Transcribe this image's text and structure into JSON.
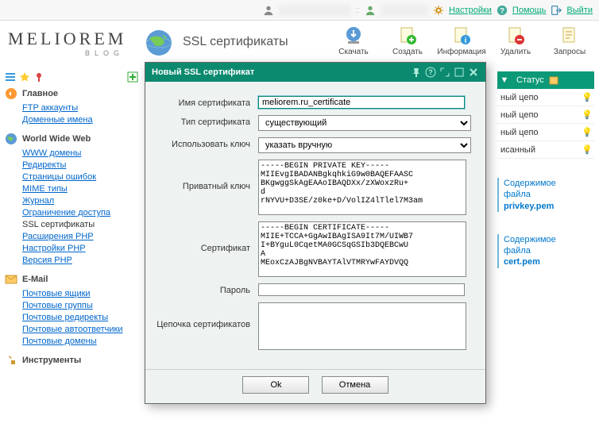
{
  "topbar": {
    "settings": "Настройки",
    "help": "Помощь",
    "logout": "Выйти"
  },
  "logo": {
    "main": "MELIOREM",
    "sub": "BLOG"
  },
  "page_title": "SSL сертификаты",
  "tools": {
    "download": "Скачать",
    "create": "Создать",
    "info": "Информация",
    "delete": "Удалить",
    "requests": "Запросы"
  },
  "sidebar": {
    "main": {
      "head": "Главное",
      "items": [
        "FTP аккаунты",
        "Доменные имена"
      ]
    },
    "www": {
      "head": "World Wide Web",
      "items": [
        "WWW домены",
        "Редиректы",
        "Страницы ошибок",
        "MIME типы",
        "Журнал",
        "Ограничение доступа"
      ],
      "current": "SSL сертификаты",
      "items2": [
        "Расширения PHP",
        "Настройки PHP",
        "Версия PHP"
      ]
    },
    "email": {
      "head": "E-Mail",
      "items": [
        "Почтовые ящики",
        "Почтовые группы",
        "Почтовые редиректы",
        "Почтовые автоответчики",
        "Почтовые домены"
      ]
    },
    "tools": {
      "head": "Инструменты"
    }
  },
  "rightcol": {
    "status_head": "Статус",
    "rows": [
      "ный цепо",
      "ный цепо",
      "ный цепо",
      "исанный"
    ],
    "anno1": [
      "Содержимое",
      "файла",
      "privkey.pem"
    ],
    "anno2": [
      "Содержимое",
      "файла",
      "cert.pem"
    ]
  },
  "modal": {
    "title": "Новый SSL сертификат",
    "labels": {
      "name": "Имя сертификата",
      "type": "Тип сертификата",
      "usekey": "Использовать ключ",
      "private": "Приватный ключ",
      "cert": "Сертификат",
      "password": "Пароль",
      "chain": "Цепочка сертификатов"
    },
    "values": {
      "name": "meliorem.ru_certificate",
      "type": "существующий",
      "usekey": "указать вручную",
      "private": "-----BEGIN PRIVATE KEY-----\nMIIEvgIBADANBgkqhkiG9w0BAQEFAASC\nBKgwggSkAgEAAoIBAQDXx/zXWoxzRu+\nd\nrNYVU+D3SE/z0ke+D/VolIZ4lTlel7M3am",
      "cert": "-----BEGIN CERTIFICATE-----\nMIIE+TCCA+GgAwIBAgISA9It7M/UIWB7\nI+BYguL0CqetMA0GCSqGSIb3DQEBCwU\nA\nMEoxCzAJBgNVBAYTAlVTMRYwFAYDVQQ",
      "password": "",
      "chain": ""
    },
    "buttons": {
      "ok": "Ok",
      "cancel": "Отмена"
    }
  }
}
